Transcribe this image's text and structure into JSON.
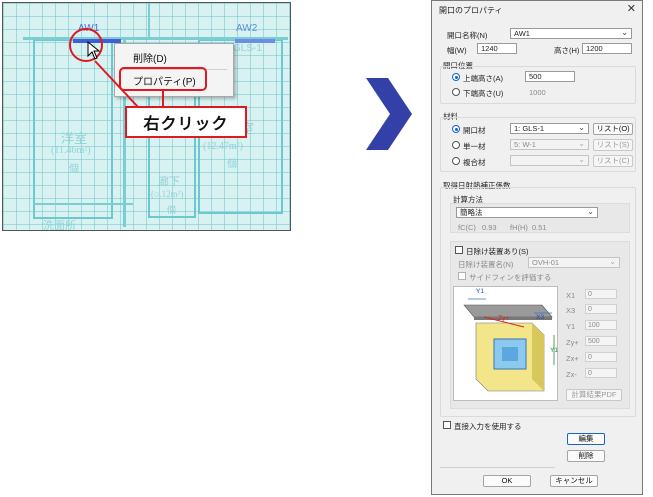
{
  "cad": {
    "openings": [
      {
        "id": "AW1",
        "type": "GLS-1"
      },
      {
        "id": "AW2",
        "type": "GLS-1"
      }
    ],
    "rooms": [
      {
        "name": "洋室",
        "area": "(11.46m²)",
        "mark": "個"
      },
      {
        "name": "洋室",
        "area": "(12.47m²)",
        "mark": "個"
      },
      {
        "name": "廊下",
        "area": "(○.12m²)",
        "mark": "個"
      },
      {
        "name": "洗面所",
        "area": "",
        "mark": ""
      }
    ],
    "context_menu": {
      "delete": "削除(D)",
      "properties": "プロパティ(P)"
    },
    "callout": "右クリック",
    "colors": {
      "accent": "#e2181f",
      "arrow": "#3340a8",
      "selected": "#3f5fd8"
    }
  },
  "dialog": {
    "title": "開口のプロパティ",
    "close": "✕",
    "name_label": "開口名称(N)",
    "name_value": "AW1",
    "width_label": "幅(W)",
    "width_value": "1240",
    "height_label": "高さ(H)",
    "height_value": "1200",
    "position": {
      "header": "開口位置",
      "top_label": "上端高さ(A)",
      "top_value": "500",
      "bottom_label": "下端高さ(U)",
      "bottom_value": "1000"
    },
    "material": {
      "header": "材料",
      "opening_label": "開口材",
      "opening_value": "1: GLS-1",
      "single_label": "単一材",
      "single_value": "5: W-1",
      "composite_label": "複合材",
      "composite_value": "",
      "list_o": "リスト(O)",
      "list_s": "リスト(S)",
      "list_c": "リスト(C)"
    },
    "solar": {
      "header": "取得日射熱補正係数",
      "calc_label": "計算方法",
      "calc_value": "簡略法",
      "fc_label": "fC(C)",
      "fc_value": "0.93",
      "fh_label": "fH(H)",
      "fh_value": "0.51",
      "shade_label": "日除け装置あり(S)",
      "shade_name_label": "日除け装置名(N)",
      "shade_name_value": "OVH-01",
      "sidefin_label": "サイドフィンを評価する",
      "params": [
        {
          "label": "X1",
          "value": "0"
        },
        {
          "label": "X3",
          "value": "0"
        },
        {
          "label": "Y1",
          "value": "100"
        },
        {
          "label": "Zy+",
          "value": "500"
        },
        {
          "label": "Zx+",
          "value": "0"
        },
        {
          "label": "Zx-",
          "value": "0"
        }
      ],
      "fig_labels": {
        "y1": "Y1",
        "x3": "X3",
        "zy": "Zy+",
        "y1b": "Y1"
      },
      "pdf_button": "計算結果PDF"
    },
    "direct_input_label": "直接入力を使用する",
    "edit_button": "編集",
    "delete_button": "削除",
    "ok_button": "OK",
    "cancel_button": "キャンセル"
  }
}
